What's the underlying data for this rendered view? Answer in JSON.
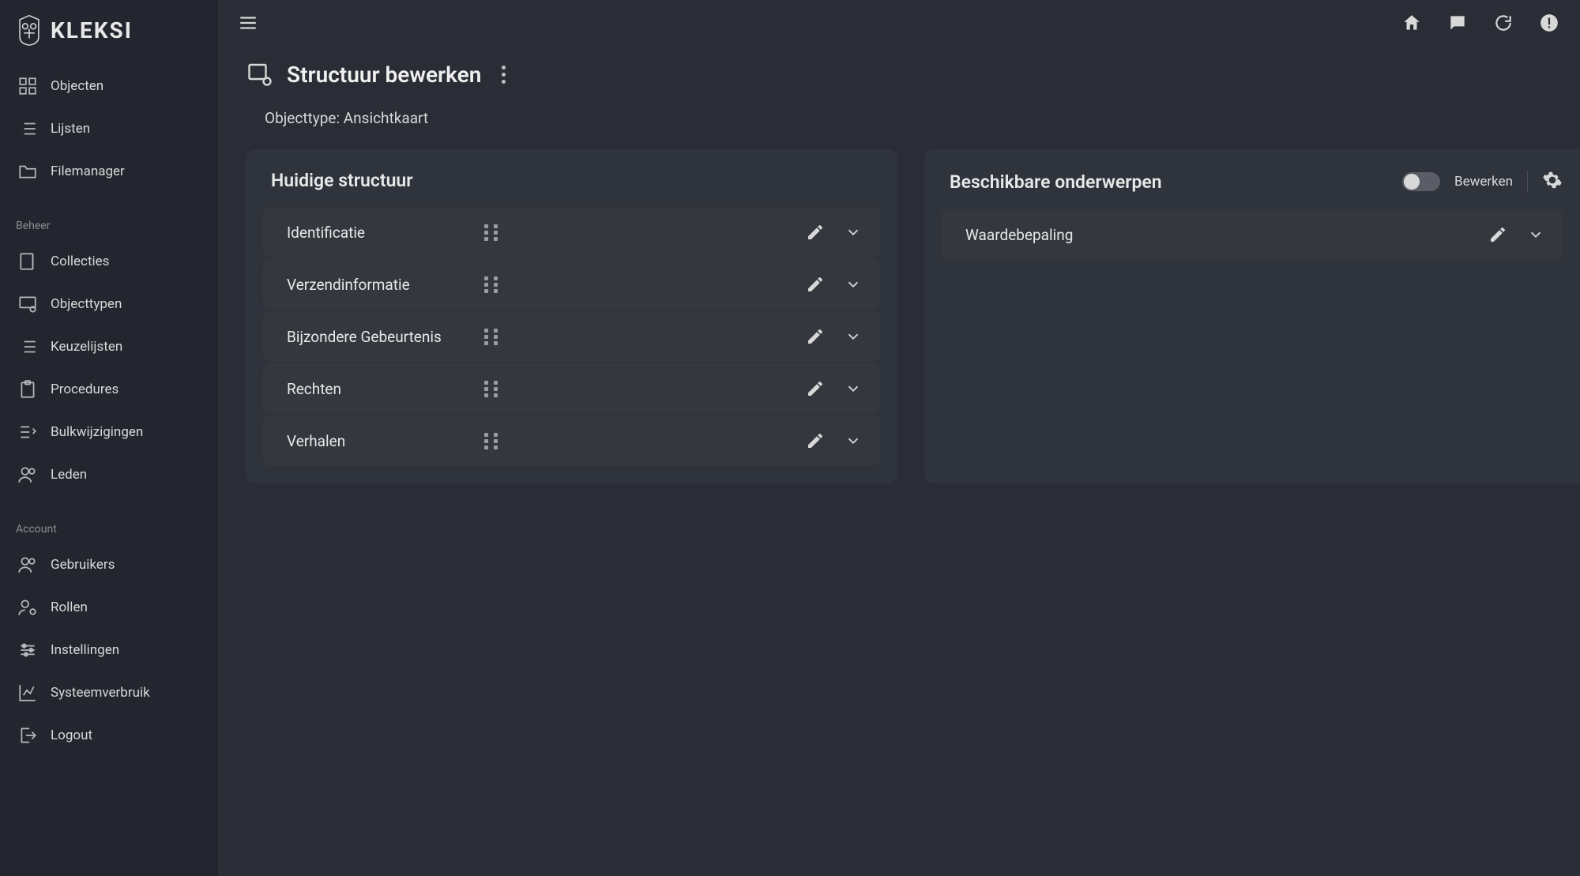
{
  "brand": "KLEKSI",
  "sidebar": {
    "main_items": [
      {
        "label": "Objecten",
        "icon": "grid"
      },
      {
        "label": "Lijsten",
        "icon": "list"
      },
      {
        "label": "Filemanager",
        "icon": "folder"
      }
    ],
    "groups": [
      {
        "heading": "Beheer",
        "items": [
          {
            "label": "Collecties",
            "icon": "book"
          },
          {
            "label": "Objecttypen",
            "icon": "monitor-gear"
          },
          {
            "label": "Keuzelijsten",
            "icon": "list"
          },
          {
            "label": "Procedures",
            "icon": "clipboard"
          },
          {
            "label": "Bulkwijzigingen",
            "icon": "bulk"
          },
          {
            "label": "Leden",
            "icon": "users"
          }
        ]
      },
      {
        "heading": "Account",
        "items": [
          {
            "label": "Gebruikers",
            "icon": "users"
          },
          {
            "label": "Rollen",
            "icon": "user-gear"
          },
          {
            "label": "Instellingen",
            "icon": "sliders"
          },
          {
            "label": "Systeemverbruik",
            "icon": "chart"
          },
          {
            "label": "Logout",
            "icon": "logout"
          }
        ]
      }
    ]
  },
  "header": {
    "title": "Structuur bewerken",
    "subtitle": "Objecttype: Ansichtkaart"
  },
  "panels": {
    "current": {
      "title": "Huidige structuur",
      "items": [
        {
          "label": "Identificatie"
        },
        {
          "label": "Verzendinformatie"
        },
        {
          "label": "Bijzondere Gebeurtenis"
        },
        {
          "label": "Rechten"
        },
        {
          "label": "Verhalen"
        }
      ]
    },
    "available": {
      "title": "Beschikbare onderwerpen",
      "toggle_label": "Bewerken",
      "items": [
        {
          "label": "Waardebepaling"
        }
      ]
    }
  }
}
